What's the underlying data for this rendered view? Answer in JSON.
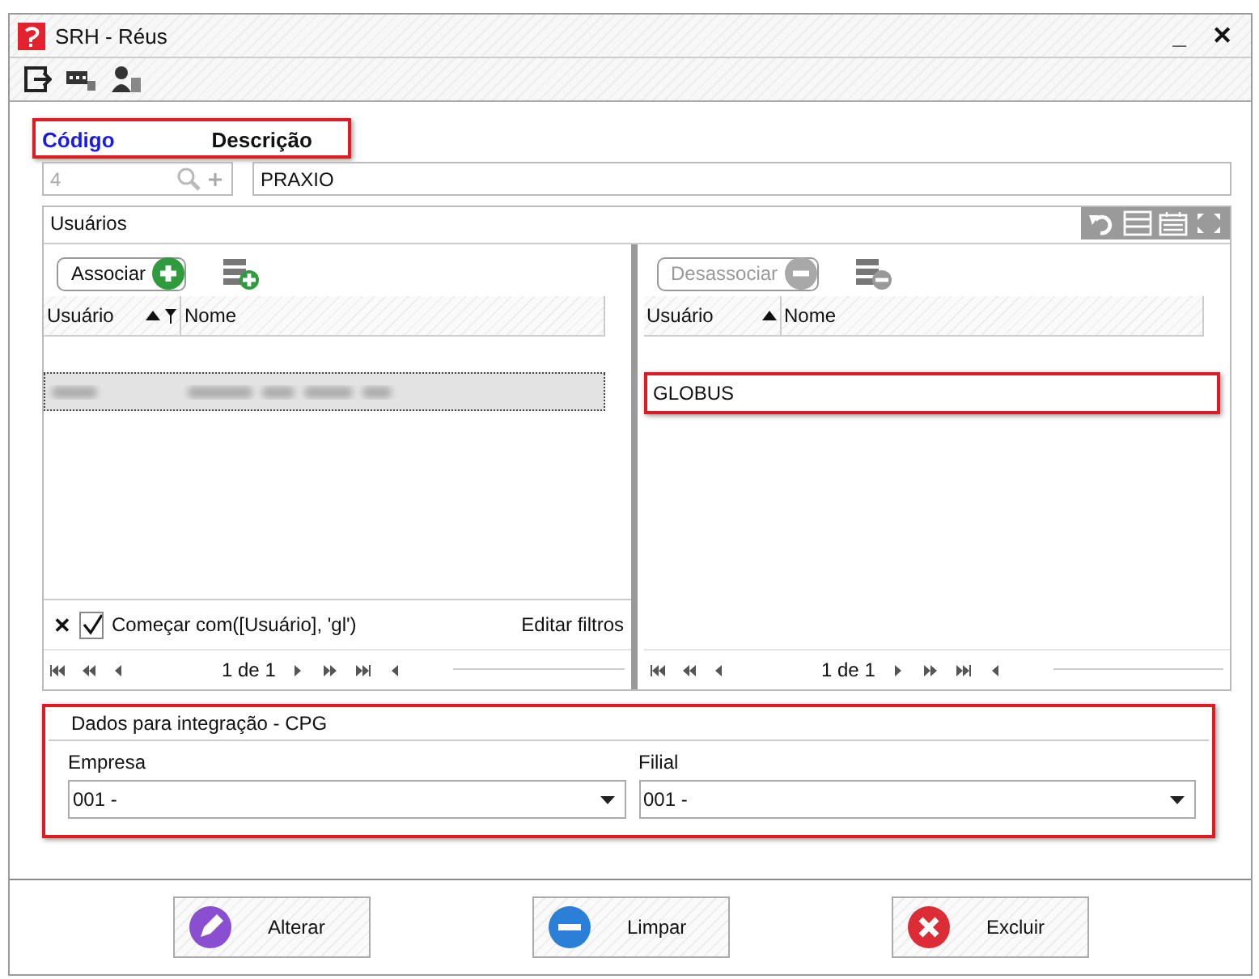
{
  "window": {
    "title": "SRH - Réus",
    "controls": [
      "_",
      "✕"
    ]
  },
  "header": {
    "labels": [
      {
        "text": "Código",
        "kind": "key"
      },
      {
        "text": "Descrição",
        "kind": "plain"
      }
    ],
    "highlighted": true
  },
  "codigo": {
    "value": "4",
    "disabled": true
  },
  "descricao": {
    "value": "PRAXIO"
  },
  "usuarios": {
    "title": "Usuários",
    "left": {
      "button": {
        "label": "Associar",
        "disabled": false
      },
      "columns": [
        {
          "label": "Usuário",
          "sorted": true,
          "filtered": true
        },
        {
          "label": "Nome",
          "sorted": false,
          "filtered": false
        }
      ],
      "rows": [
        {
          "selected": true,
          "redacted": true,
          "highlighted": false
        }
      ],
      "filter": {
        "text": "Começar com([Usuário], 'gl')",
        "checked": true,
        "clear": "✕",
        "edit": "Editar filtros"
      },
      "pager": "1 de 1"
    },
    "right": {
      "button": {
        "label": "Desassociar",
        "disabled": true
      },
      "columns": [
        {
          "label": "Usuário",
          "sorted": true,
          "filtered": false
        },
        {
          "label": "Nome",
          "sorted": false,
          "filtered": false
        }
      ],
      "rows": [
        {
          "usuario": "GLOBUS",
          "selected": false,
          "redacted": false,
          "highlighted": true
        }
      ],
      "pager": "1 de 1"
    }
  },
  "integracao": {
    "title": "Dados para integração - CPG",
    "highlighted": true,
    "fields": [
      {
        "label": "Empresa",
        "value": "001 -"
      },
      {
        "label": "Filial",
        "value": "001 -"
      }
    ]
  },
  "buttons": [
    {
      "label": "Alterar",
      "kind": "edit"
    },
    {
      "label": "Limpar",
      "kind": "clear"
    },
    {
      "label": "Excluir",
      "kind": "delete"
    }
  ]
}
